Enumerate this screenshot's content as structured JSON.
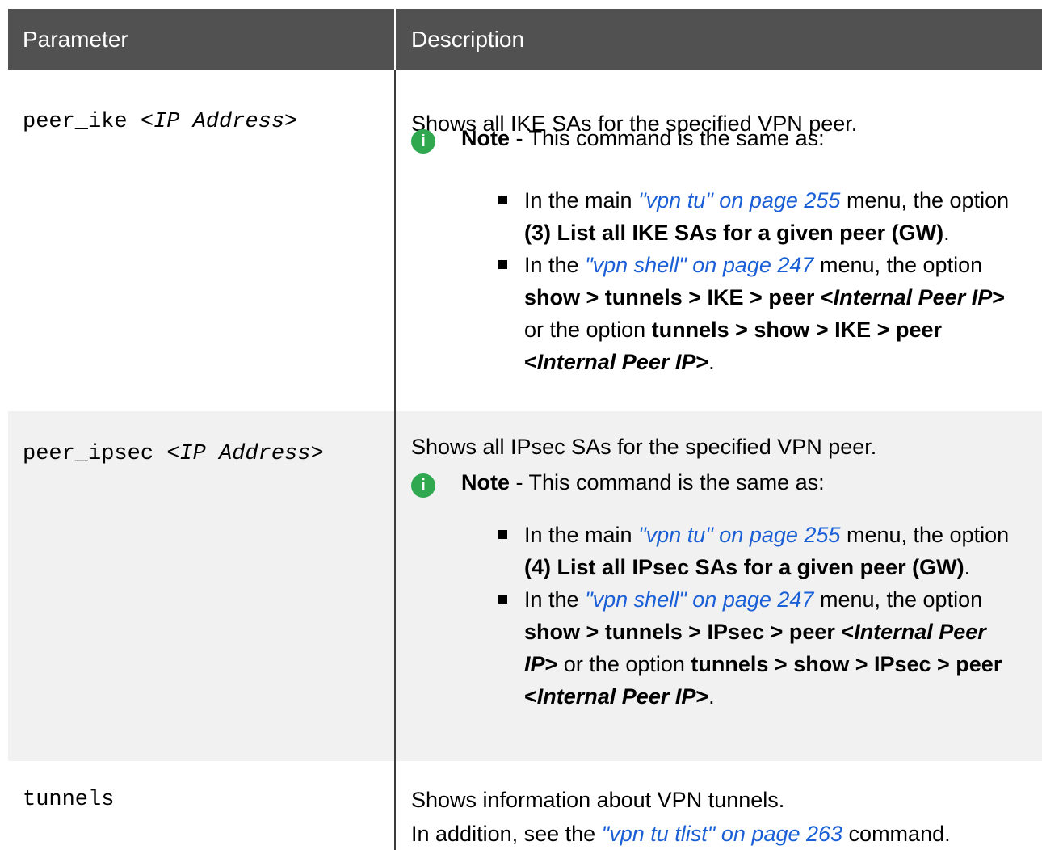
{
  "header": {
    "parameter": "Parameter",
    "description": "Description"
  },
  "rows": [
    {
      "param_name": "peer_ike ",
      "param_arg": "<IP Address>",
      "summary": "Shows all IKE SAs for the specified VPN peer.",
      "note_label": "Note",
      "note_text": " - This command is the same as:",
      "item1": {
        "pre": "In the main ",
        "link": "\"vpn tu\" on page 255",
        "mid": " menu, the option ",
        "bold": "(3) List all IKE SAs for a given peer (GW)",
        "post": "."
      },
      "item2": {
        "pre": "In the ",
        "link": "\"vpn shell\" on page 247",
        "mid": " menu, the option ",
        "bold1": "show > tunnels > IKE > peer <",
        "italic1": "Internal Peer IP",
        "close1": ">",
        "or": " or the option ",
        "bold2": "tunnels > show > IKE > peer <",
        "italic2": "Internal Peer IP",
        "close2": ">",
        "post": "."
      }
    },
    {
      "param_name": "peer_ipsec ",
      "param_arg": "<IP Address>",
      "summary": "Shows all IPsec SAs for the specified VPN peer.",
      "note_label": "Note",
      "note_text": " - This command is the same as:",
      "item1": {
        "pre": "In the main ",
        "link": "\"vpn tu\" on page 255",
        "mid": " menu, the option ",
        "bold": "(4) List all IPsec SAs for a given peer (GW)",
        "post": "."
      },
      "item2": {
        "pre": "In the ",
        "link": "\"vpn shell\" on page 247",
        "mid": " menu, the option ",
        "bold1": "show > tunnels > IPsec > peer <",
        "italic1": "Internal Peer IP",
        "close1": ">",
        "or": " or the option ",
        "bold2": "tunnels > show > IPsec > peer <",
        "italic2": "Internal Peer IP",
        "close2": ">",
        "post": "."
      }
    },
    {
      "param_name": "tunnels",
      "line1": "Shows information about VPN tunnels.",
      "line2_pre": "In addition, see the ",
      "line2_link": "\"vpn tu tlist\" on page 263",
      "line2_post": " command."
    }
  ],
  "colors": {
    "header_bg": "#515151",
    "alt_row_bg": "#f1f1f1",
    "link": "#1a5fd6",
    "note_icon": "#2fa84f"
  },
  "icons": {
    "note": "info-icon"
  }
}
